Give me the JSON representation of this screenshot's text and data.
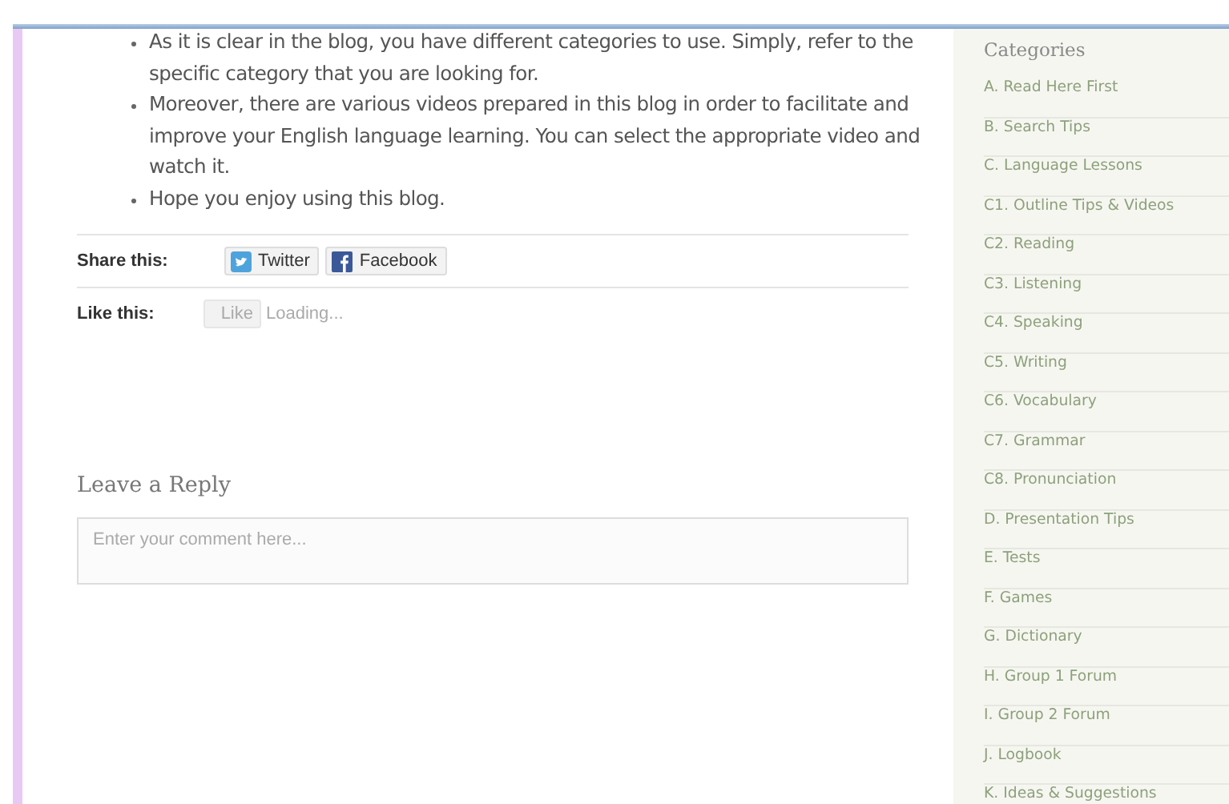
{
  "post": {
    "bullets": [
      "As it is clear in the blog, you have different categories to use. Simply, refer to the specific category that you are looking for.",
      "Moreover, there are various videos prepared in this blog in order to facilitate and improve your English language learning. You can select the appropriate video and watch it.",
      "Hope you enjoy using this blog."
    ]
  },
  "share": {
    "label": "Share this:",
    "buttons": [
      {
        "kind": "twitter",
        "label": "Twitter"
      },
      {
        "kind": "facebook",
        "label": "Facebook"
      }
    ]
  },
  "like": {
    "label": "Like this:",
    "button": "Like",
    "status": "Loading..."
  },
  "reply": {
    "title": "Leave a Reply",
    "placeholder": "Enter your comment here..."
  },
  "sidebar": {
    "title": "Categories",
    "items": [
      "A. Read Here First",
      "B. Search Tips",
      "C. Language Lessons",
      "C1. Outline Tips & Videos",
      "C2. Reading",
      "C3. Listening",
      "C4. Speaking",
      "C5. Writing",
      "C6. Vocabulary",
      "C7. Grammar",
      "C8. Pronunciation",
      "D. Presentation Tips",
      "E. Tests",
      "F. Games",
      "G. Dictionary",
      "H. Group 1 Forum",
      "I. Group 2 Forum",
      "J. Logbook",
      "K. Ideas & Suggestions"
    ]
  }
}
